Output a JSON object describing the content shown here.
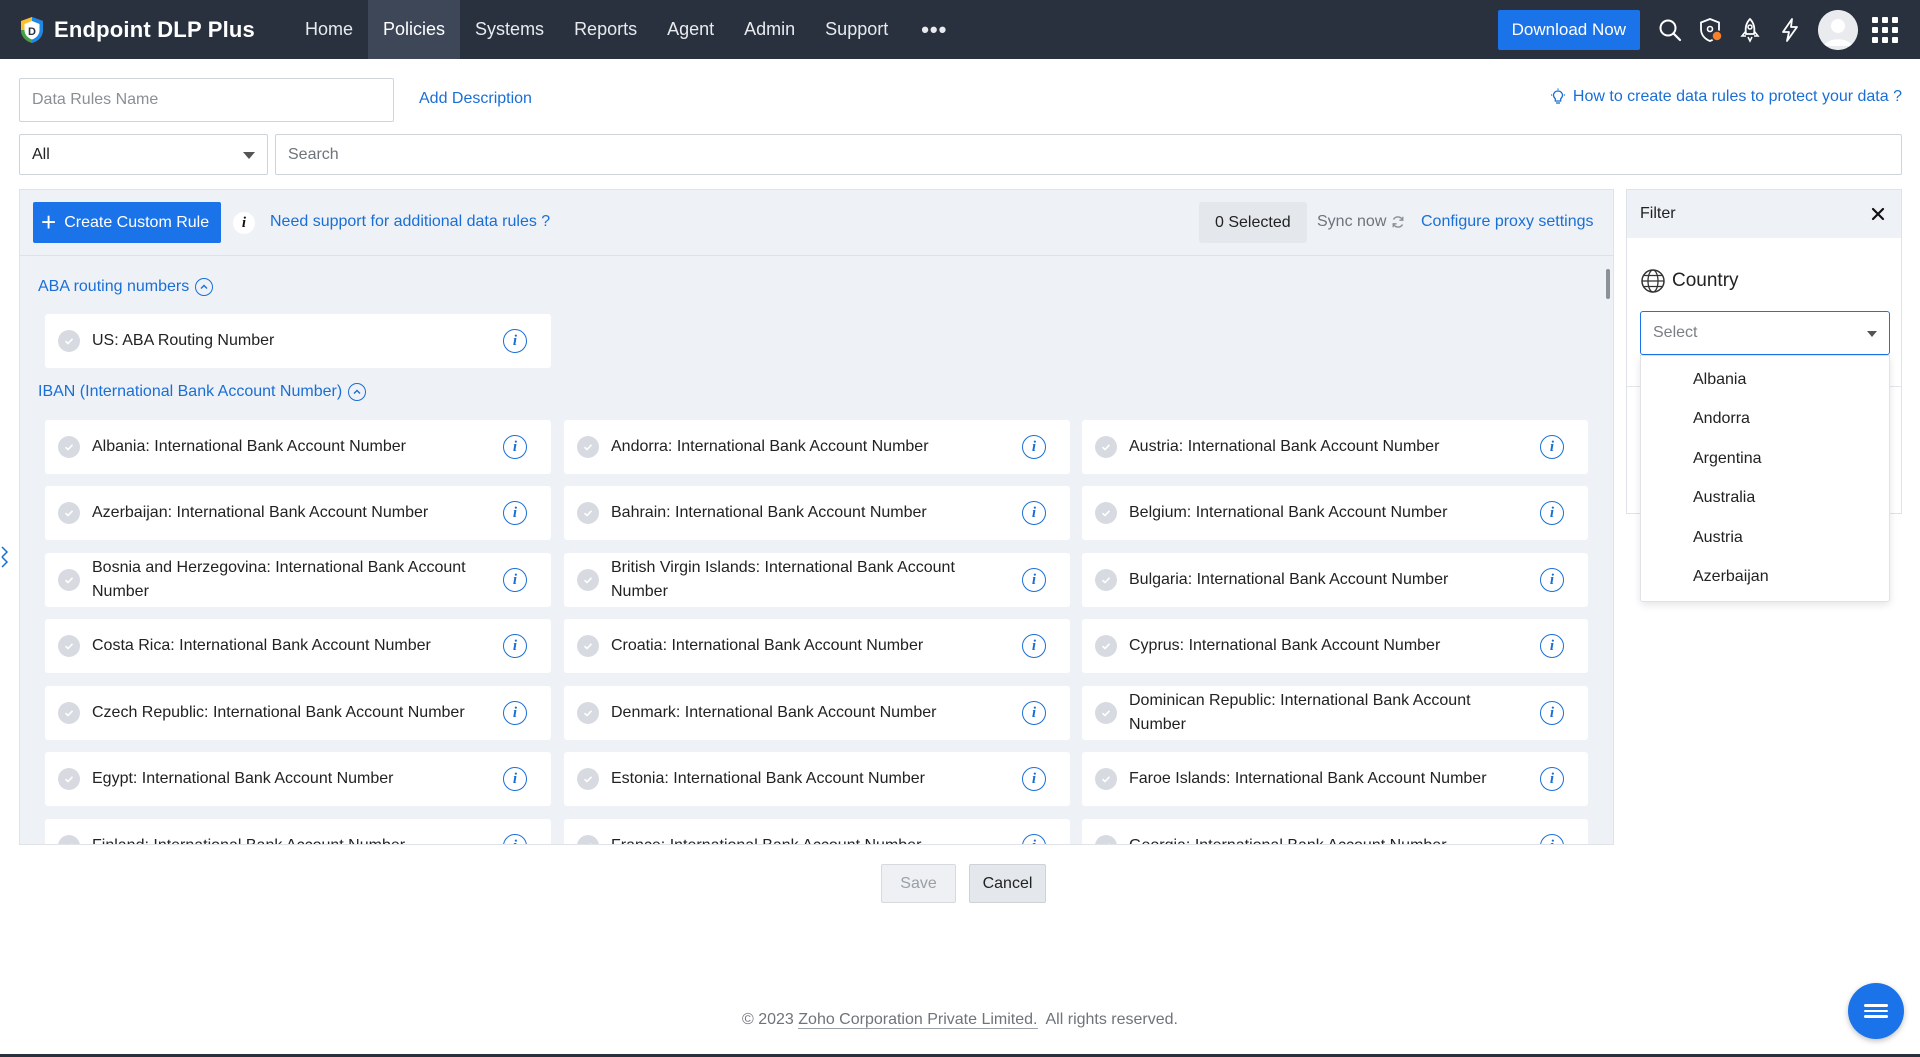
{
  "app": {
    "brand": "Endpoint DLP Plus",
    "nav": [
      {
        "label": "Home"
      },
      {
        "label": "Policies",
        "active": true
      },
      {
        "label": "Systems"
      },
      {
        "label": "Reports"
      },
      {
        "label": "Agent"
      },
      {
        "label": "Admin"
      },
      {
        "label": "Support"
      }
    ],
    "more": "•••",
    "download_label": "Download Now",
    "colors": {
      "topbar": "#2a313e",
      "accent": "#1a73e8",
      "link": "#1a6fd6",
      "notification_dot": "#f7812a"
    }
  },
  "form": {
    "rules_name_placeholder": "Data Rules Name",
    "add_description": "Add Description",
    "howto": "How to create data rules to protect your data ?",
    "category_select": "All",
    "search_placeholder": "Search"
  },
  "toolbar": {
    "create_label": "Create Custom Rule",
    "info_glyph": "i",
    "need_support": "Need support for additional data rules ?",
    "selected": "0 Selected",
    "sync": "Sync now",
    "proxy": "Configure proxy settings"
  },
  "groups": [
    {
      "title": "ABA routing numbers",
      "rules": [
        "US: ABA Routing Number"
      ]
    },
    {
      "title": "IBAN (International Bank Account Number)",
      "rules": [
        "Albania: International Bank Account Number",
        "Andorra: International Bank Account Number",
        "Austria: International Bank Account Number",
        "Azerbaijan: International Bank Account Number",
        "Bahrain: International Bank Account Number",
        "Belgium: International Bank Account Number",
        "Bosnia and Herzegovina: International Bank Account Number",
        "British Virgin Islands: International Bank Account Number",
        "Bulgaria: International Bank Account Number",
        "Costa Rica: International Bank Account Number",
        "Croatia: International Bank Account Number",
        "Cyprus: International Bank Account Number",
        "Czech Republic: International Bank Account Number",
        "Denmark: International Bank Account Number",
        "Dominican Republic: International Bank Account Number",
        "Egypt: International Bank Account Number",
        "Estonia: International Bank Account Number",
        "Faroe Islands: International Bank Account Number",
        "Finland: International Bank Account Number",
        "France: International Bank Account Number",
        "Georgia: International Bank Account Number"
      ]
    }
  ],
  "filter": {
    "title": "Filter",
    "country_label": "Country",
    "select_placeholder": "Select",
    "options": [
      "Albania",
      "Andorra",
      "Argentina",
      "Australia",
      "Austria",
      "Azerbaijan"
    ]
  },
  "actions": {
    "save": "Save",
    "cancel": "Cancel"
  },
  "footer": {
    "prefix": "© 2023 ",
    "company": "Zoho Corporation Private Limited.",
    "suffix": "  All rights reserved."
  }
}
